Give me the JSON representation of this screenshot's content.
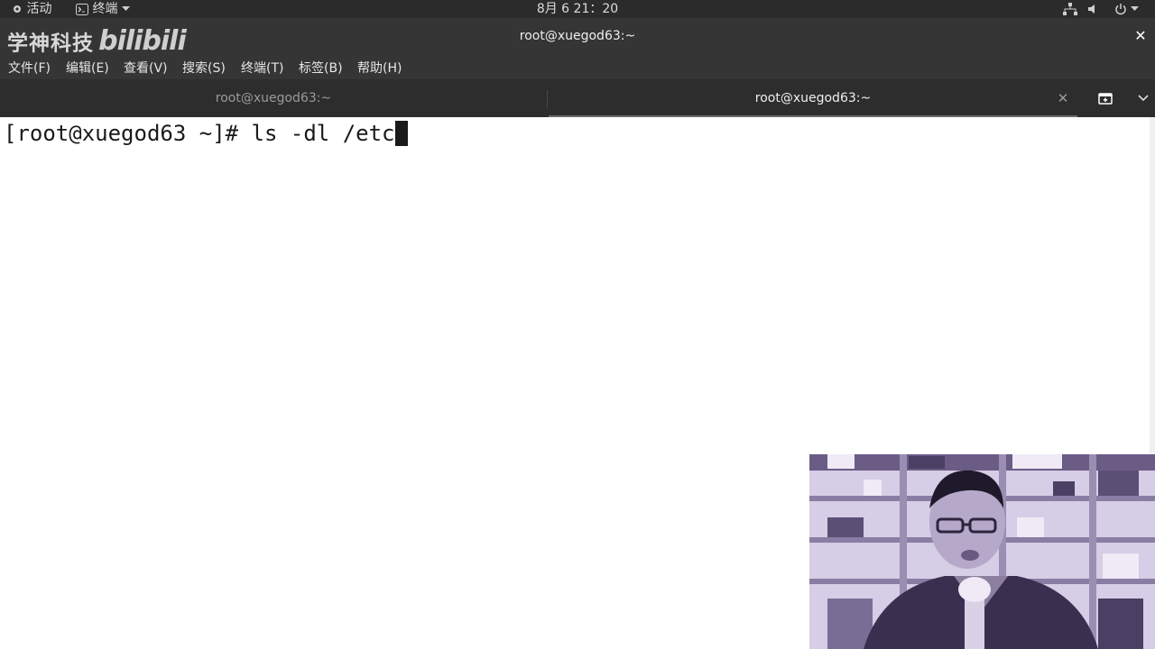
{
  "topbar": {
    "activities": "活动",
    "app_menu": "终端",
    "clock": "8月 6  21：20"
  },
  "header": {
    "logo_text": "学神科技",
    "logo_brand": "bilibili",
    "window_title": "root@xuegod63:~",
    "close_glyph": "✕"
  },
  "menubar": {
    "items": [
      "文件(F)",
      "编辑(E)",
      "查看(V)",
      "搜索(S)",
      "终端(T)",
      "标签(B)",
      "帮助(H)"
    ]
  },
  "tabs": [
    {
      "label": "root@xuegod63:~",
      "active": false
    },
    {
      "label": "root@xuegod63:~",
      "active": true,
      "close_glyph": "✕"
    }
  ],
  "terminal": {
    "prompt": "[root@xuegod63 ~]# ",
    "command": "ls -dl /etc"
  },
  "icons": {
    "activities": "gear-icon",
    "terminal": "terminal-icon",
    "network": "network-icon",
    "volume": "volume-icon",
    "power": "power-icon",
    "new_tab": "new-tab-icon",
    "tab_menu": "chevron-down-icon"
  },
  "colors": {
    "topbar_bg": "#2b2b2b",
    "header_bg": "#353535",
    "terminal_bg": "#ffffff",
    "terminal_fg": "#1a1a1a"
  }
}
